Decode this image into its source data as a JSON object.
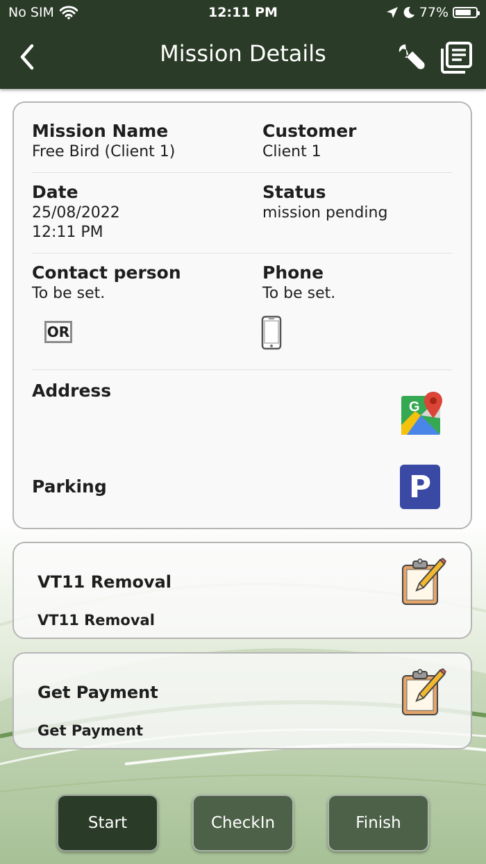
{
  "status_bar": {
    "carrier": "No SIM",
    "time": "12:11 PM",
    "battery": "77%",
    "battery_level": 0.77
  },
  "nav": {
    "title": "Mission Details",
    "back_icon": "chevron-left-icon",
    "wrench_icon": "wrench-icon",
    "list_icon": "document-list-icon"
  },
  "details": {
    "mission_name_label": "Mission Name",
    "mission_name": "Free Bird (Client 1)",
    "customer_label": "Customer",
    "customer": "Client 1",
    "date_label": "Date",
    "date": "25/08/2022\n12:11 PM",
    "status_label": "Status",
    "status": "mission pending",
    "contact_label": "Contact person",
    "contact": "To be set.",
    "phone_label": "Phone",
    "phone": "To be set.",
    "or_badge": "OR",
    "address_label": "Address",
    "parking_label": "Parking",
    "parking_icon_letter": "P"
  },
  "tasks": [
    {
      "title": "VT11 Removal",
      "subtitle": "VT11 Removal"
    },
    {
      "title": "Get Payment",
      "subtitle": "Get Payment"
    }
  ],
  "buttons": {
    "start": "Start",
    "checkin": "CheckIn",
    "finish": "Finish"
  },
  "colors": {
    "header_bg": "#2a3b27",
    "start_btn": "#2a3b27",
    "secondary_btn": "#4c6148",
    "parking_blue": "#3949a4"
  }
}
